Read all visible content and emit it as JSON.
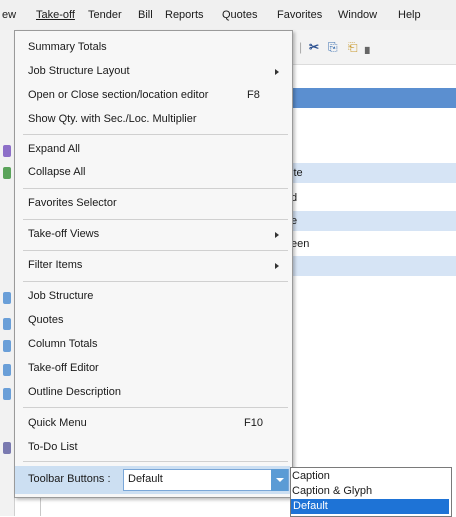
{
  "menubar": [
    {
      "key": "view",
      "label": "ew"
    },
    {
      "key": "takeoff",
      "label": "Take-off",
      "u": "T"
    },
    {
      "key": "tender",
      "label": "Tender"
    },
    {
      "key": "bill",
      "label": "Bill"
    },
    {
      "key": "reports",
      "label": "Reports"
    },
    {
      "key": "quotes",
      "label": "Quotes"
    },
    {
      "key": "favorites",
      "label": "Favorites"
    },
    {
      "key": "window",
      "label": "Window"
    },
    {
      "key": "help",
      "label": "Help"
    }
  ],
  "background": {
    "rows": [
      "ite",
      "d",
      "e",
      "een"
    ]
  },
  "menu": {
    "items": [
      {
        "name": "summary-totals",
        "label": "Summary Totals"
      },
      {
        "name": "job-structure-layout",
        "label": "Job Structure Layout",
        "submenu": true
      },
      {
        "name": "open-close-section-editor",
        "label": "Open or Close section/location editor",
        "shortcut": "F8"
      },
      {
        "name": "show-qty-multiplier",
        "label": "Show Qty. with Sec./Loc. Multiplier"
      },
      {
        "name": "expand-all",
        "label": "Expand All"
      },
      {
        "name": "collapse-all",
        "label": "Collapse All"
      },
      {
        "name": "favorites-selector",
        "label": "Favorites Selector"
      },
      {
        "name": "takeoff-views",
        "label": "Take-off Views",
        "submenu": true
      },
      {
        "name": "filter-items",
        "label": "Filter Items",
        "submenu": true
      },
      {
        "name": "job-structure",
        "label": "Job Structure"
      },
      {
        "name": "quotes",
        "label": "Quotes"
      },
      {
        "name": "column-totals",
        "label": "Column Totals"
      },
      {
        "name": "takeoff-editor",
        "label": "Take-off Editor"
      },
      {
        "name": "outline-description",
        "label": "Outline Description"
      },
      {
        "name": "quick-menu",
        "label": "Quick Menu",
        "shortcut": "F10"
      },
      {
        "name": "todo-list",
        "label": "To-Do List"
      }
    ],
    "toolbar_buttons_label": "Toolbar Buttons :",
    "toolbar_buttons_value": "Default"
  },
  "toolbar_options": [
    "Caption",
    "Caption & Glyph",
    "Default"
  ],
  "colors": {
    "selection": "#1e73d6",
    "row_highlight": "#ccdff2",
    "band": "#d6e4f5"
  }
}
